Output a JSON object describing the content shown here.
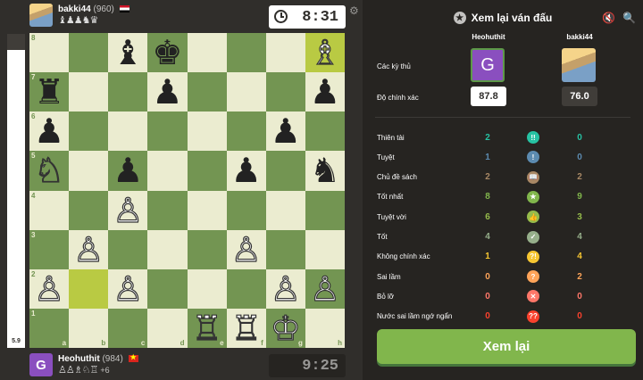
{
  "players": {
    "top": {
      "name": "bakki44",
      "rating": "(960)",
      "captured": "♝♟♟♞♛",
      "clock": "8:31"
    },
    "bottom": {
      "name": "Heohuthit",
      "rating": "(984)",
      "avatar_letter": "G",
      "captured": "♙♙♗♘♖",
      "advantage": "+6",
      "clock": "9:25"
    }
  },
  "eval": {
    "value": "5.9",
    "white_fraction": 0.95
  },
  "board": {
    "ranks": [
      "8",
      "7",
      "6",
      "5",
      "4",
      "3",
      "2",
      "1"
    ],
    "files": [
      "a",
      "b",
      "c",
      "d",
      "e",
      "f",
      "g",
      "h"
    ],
    "position": [
      [
        "",
        "",
        "b:♝",
        "b:♚",
        "",
        "",
        "",
        "w:♗"
      ],
      [
        "b:♜",
        "",
        "",
        "b:♟",
        "",
        "",
        "",
        "b:♟"
      ],
      [
        "b:♟",
        "",
        "",
        "",
        "",
        "",
        "b:♟",
        ""
      ],
      [
        "w:♘",
        "",
        "b:♟",
        "",
        "",
        "b:♟",
        "",
        "b:♞"
      ],
      [
        "",
        "",
        "w:♙",
        "",
        "",
        "",
        "",
        ""
      ],
      [
        "",
        "w:♙",
        "",
        "",
        "",
        "w:♙",
        "",
        ""
      ],
      [
        "w:♙",
        "",
        "w:♙",
        "",
        "",
        "",
        "w:♙",
        "w:♙"
      ],
      [
        "",
        "",
        "",
        "",
        "w:♖",
        "w:♖",
        "w:♔",
        ""
      ]
    ],
    "highlight": [
      "h8",
      "b2"
    ]
  },
  "panel": {
    "title": "Xem lại ván đấu",
    "players_label": "Các kỳ thủ",
    "accuracy_label": "Độ chính xác",
    "white_name": "Heohuthit",
    "black_name": "bakki44",
    "white_accuracy": "87.8",
    "black_accuracy": "76.0",
    "classifications": [
      {
        "label": "Thiên tài",
        "white": "2",
        "black": "0",
        "icon": "!!",
        "color": "#26c2a3"
      },
      {
        "label": "Tuyệt",
        "white": "1",
        "black": "0",
        "icon": "!",
        "color": "#5c8bb0"
      },
      {
        "label": "Chủ đề sách",
        "white": "2",
        "black": "2",
        "icon": "📖",
        "color": "#a88865"
      },
      {
        "label": "Tốt nhất",
        "white": "8",
        "black": "9",
        "icon": "★",
        "color": "#81b64c"
      },
      {
        "label": "Tuyệt vời",
        "white": "6",
        "black": "3",
        "icon": "👍",
        "color": "#96bc4b"
      },
      {
        "label": "Tốt",
        "white": "4",
        "black": "4",
        "icon": "✓",
        "color": "#96af8b"
      },
      {
        "label": "Không chính xác",
        "white": "1",
        "black": "4",
        "icon": "?!",
        "color": "#f7c631"
      },
      {
        "label": "Sai lầm",
        "white": "0",
        "black": "2",
        "icon": "?",
        "color": "#ffa459"
      },
      {
        "label": "Bỏ lỡ",
        "white": "0",
        "black": "0",
        "icon": "✕",
        "color": "#ff7769"
      },
      {
        "label": "Nước sai lầm ngớ ngẩn",
        "white": "0",
        "black": "0",
        "icon": "??",
        "color": "#fa412d"
      }
    ],
    "review_button": "Xem lại"
  },
  "colors": {
    "win": "#81b64c",
    "board_light": "#ebecd0",
    "board_dark": "#739552"
  }
}
